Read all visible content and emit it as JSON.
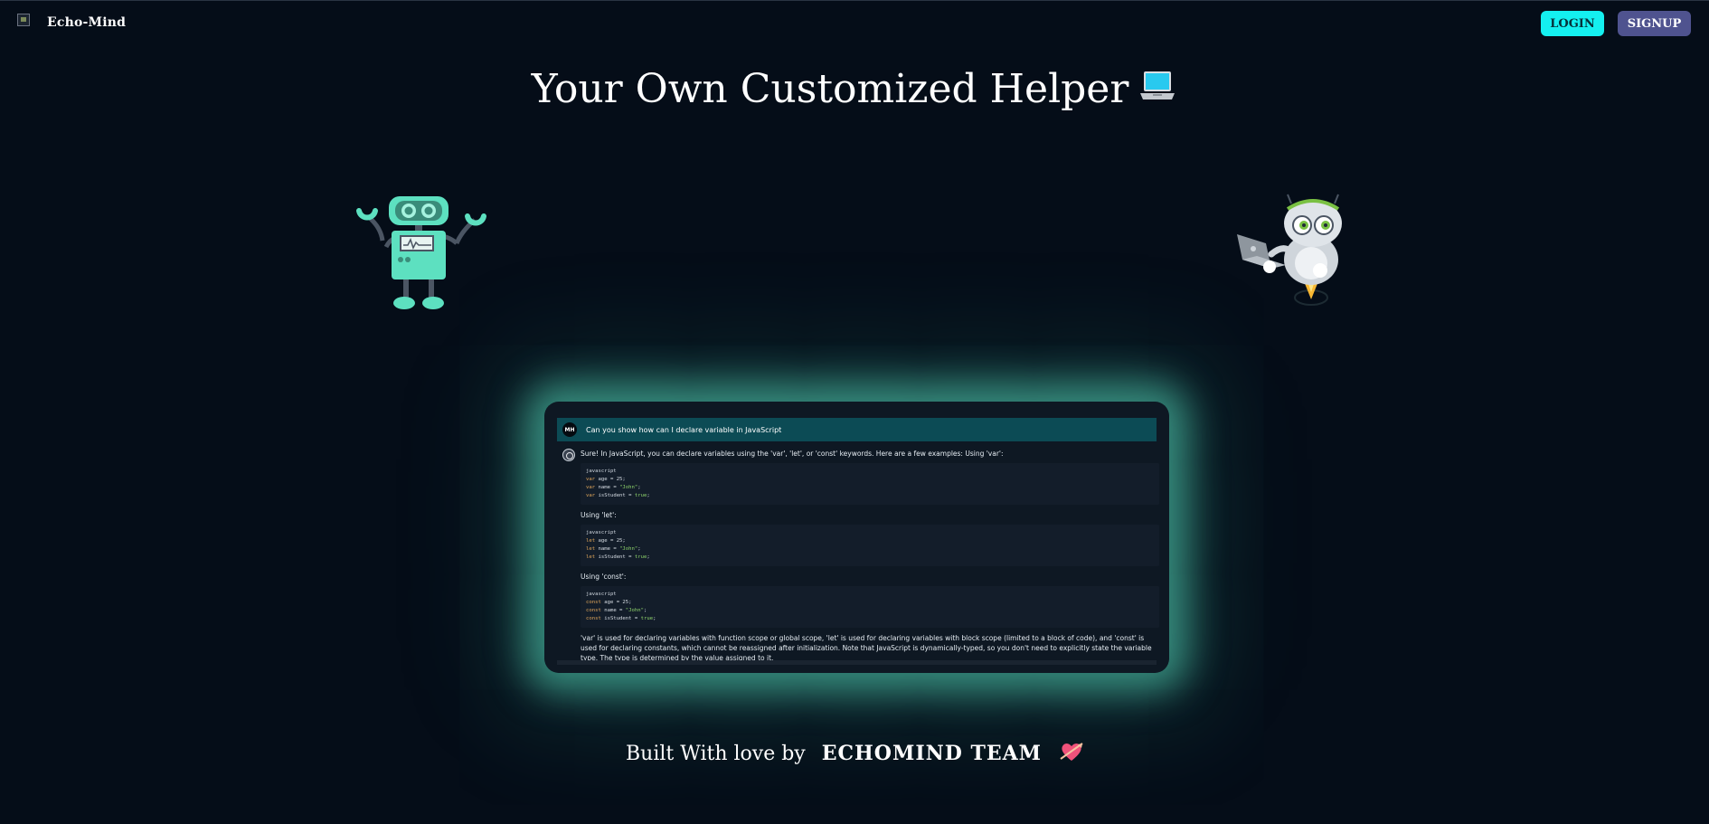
{
  "header": {
    "brand": "Echo-Mind",
    "login_label": "LOGIN",
    "signup_label": "SIGNUP"
  },
  "hero": {
    "title": "Your Own Customized Helper"
  },
  "chat_preview": {
    "user_initials": "MH",
    "question": "Can you show how can I declare variable in JavaScript",
    "intro": "Sure! In JavaScript, you can declare variables using the 'var', 'let', or 'const' keywords. Here are a few examples: Using 'var':",
    "code_lang": "javascript",
    "var_block": [
      "var age = 25;",
      "var name = \"John\";",
      "var isStudent = true;"
    ],
    "let_label": "Using 'let':",
    "let_block": [
      "let age = 25;",
      "let name = \"John\";",
      "let isStudent = true;"
    ],
    "const_label": "Using 'const':",
    "const_block": [
      "const age = 25;",
      "const name = \"John\";",
      "const isStudent = true;"
    ],
    "summary": "'var' is used for declaring variables with function scope or global scope, 'let' is used for declaring variables with block scope (limited to a block of code), and 'const' is used for declaring constants, which cannot be reassigned after initialization. Note that JavaScript is dynamically-typed, so you don't need to explicitly state the variable type. The type is determined by the value assigned to it."
  },
  "footer": {
    "prefix": "Built With love by",
    "team": "ECHOMIND TEAM"
  },
  "colors": {
    "background": "#050d18",
    "login_button": "#14f0f0",
    "signup_button": "#4f538f",
    "question_row": "#0c4b55",
    "glow": "#58dcbe",
    "robot_teal": "#5de0c0"
  },
  "icons": [
    "broken-logo-image",
    "laptop-emoji",
    "teal-robot",
    "silver-robot-with-laptop",
    "heart-arrow-emoji"
  ]
}
